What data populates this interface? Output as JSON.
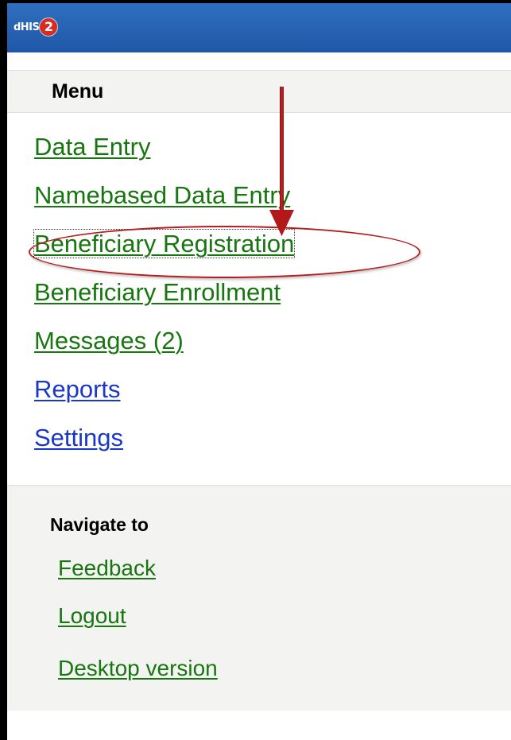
{
  "header": {
    "logo_text": "dHIS",
    "logo_badge": "2"
  },
  "menu": {
    "title": "Menu",
    "items": [
      {
        "label": "Data Entry"
      },
      {
        "label": "Namebased Data Entry"
      },
      {
        "label": "Beneficiary Registration"
      },
      {
        "label": "Beneficiary Enrollment"
      },
      {
        "label": "Messages (2)"
      },
      {
        "label": "Reports"
      },
      {
        "label": "Settings"
      }
    ]
  },
  "navigate": {
    "title": "Navigate to",
    "items": [
      {
        "label": "Feedback"
      },
      {
        "label": "Logout"
      },
      {
        "label": "Desktop version"
      }
    ]
  },
  "annotation": {
    "color": "#b81b1b",
    "target": "Beneficiary Registration"
  },
  "colors": {
    "header_bar": "#1f57a6",
    "link_green": "#17760f",
    "link_blue": "#1a37c9",
    "section_bg": "#f3f3f1"
  }
}
